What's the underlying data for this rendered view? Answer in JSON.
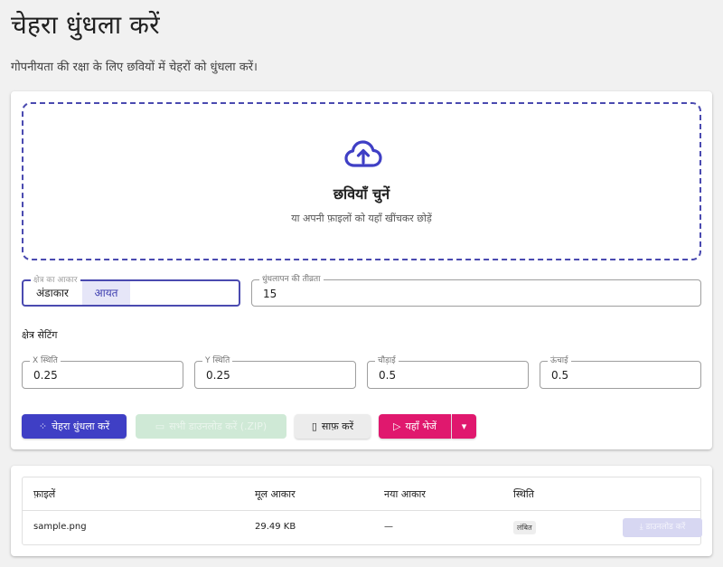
{
  "header": {
    "title": "चेहरा धुंधला करें",
    "subtitle": "गोपनीयता की रक्षा के लिए छवियों में चेहरों को धुंधला करें।"
  },
  "dropzone": {
    "icon": "cloud-upload-icon",
    "title": "छवियाँ चुनें",
    "hint": "या अपनी फ़ाइलों को यहाँ खींचकर छोड़ें"
  },
  "region_shape": {
    "label": "क्षेत्र का आकार",
    "options": [
      "अंडाकार",
      "आयत"
    ],
    "selected": "आयत"
  },
  "blur_intensity": {
    "label": "धुंधलापन की तीव्रता",
    "value": "15"
  },
  "region_settings": {
    "label": "क्षेत्र सेटिंग",
    "x": {
      "label": "X स्थिति",
      "value": "0.25"
    },
    "y": {
      "label": "Y स्थिति",
      "value": "0.25"
    },
    "width": {
      "label": "चौड़ाई",
      "value": "0.5"
    },
    "height": {
      "label": "ऊंचाई",
      "value": "0.5"
    }
  },
  "actions": {
    "blur_label": "चेहरा धुंधला करें",
    "download_all_label": "सभी डाउनलोड करें (.ZIP)",
    "clear_label": "साफ़ करें",
    "send_label": "यहाँ भेजें",
    "caret": "▾"
  },
  "files_table": {
    "headers": [
      "फ़ाइलें",
      "मूल आकार",
      "नया आकार",
      "स्थिति"
    ],
    "rows": [
      {
        "name": "sample.png",
        "original_size": "29.49 KB",
        "new_size": "—",
        "status": "लंबित",
        "download_label": "डाउनलोड करें"
      }
    ]
  },
  "colors": {
    "primary": "#3f3fc5",
    "accent": "#e0186e",
    "success_disabled": "#cfe9d6"
  }
}
